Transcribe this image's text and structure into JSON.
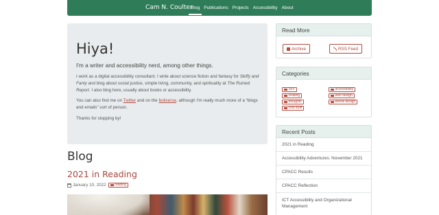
{
  "navbar": {
    "brand": "Cam N. Coulter",
    "links": [
      "Blog",
      "Publications",
      "Projects",
      "Accessibility",
      "About"
    ],
    "active": "Blog",
    "background": "#2e7d58"
  },
  "jumbotron": {
    "heading": "Hiya!",
    "lead": "I'm a writer and accessibility nerd, among other things.",
    "p1_a": "I work as a digital accessibility consultant. I write about science fiction and fantasy for ",
    "p1_em1": "Skiffy and Fanty",
    "p1_b": " and blog about social justice, simple living, community, and spirituality at ",
    "p1_em2": "The Ruined Report",
    "p1_c": ". I also blog here, usually about books or accessibility.",
    "p2_a": "You can also find me on ",
    "p2_link1": "Twitter",
    "p2_b": " and on the ",
    "p2_link2": "fediverse",
    "p2_c": ", although I'm really much more of a “blogs and emails” sort of person.",
    "p3": "Thanks for stopping by!"
  },
  "blog": {
    "heading": "Blog",
    "post": {
      "title": "2021 in Reading",
      "date": "January 10, 2022",
      "tag": "reading",
      "calendar_icon": "calendar-icon"
    }
  },
  "sidebar": {
    "read_more": {
      "heading": "Read More",
      "archive_label": "Archive",
      "rss_label": "RSS Feed"
    },
    "categories": {
      "heading": "Categories",
      "items": [
        "SFF",
        "accessibility",
        "reading",
        "web design",
        "thoughts",
        "ebook design",
        "cool stuff"
      ]
    },
    "recent_posts": {
      "heading": "Recent Posts",
      "items": [
        "2021 in Reading",
        "Accessibility Adventures: November 2021",
        "CPACC Results",
        "CPACC Reflection",
        "ICT Accessibility and Organizational Management"
      ]
    }
  },
  "colors": {
    "accent": "#b24a3d",
    "card_header": "#e6f0ec",
    "jumbotron": "#e8ecee"
  }
}
